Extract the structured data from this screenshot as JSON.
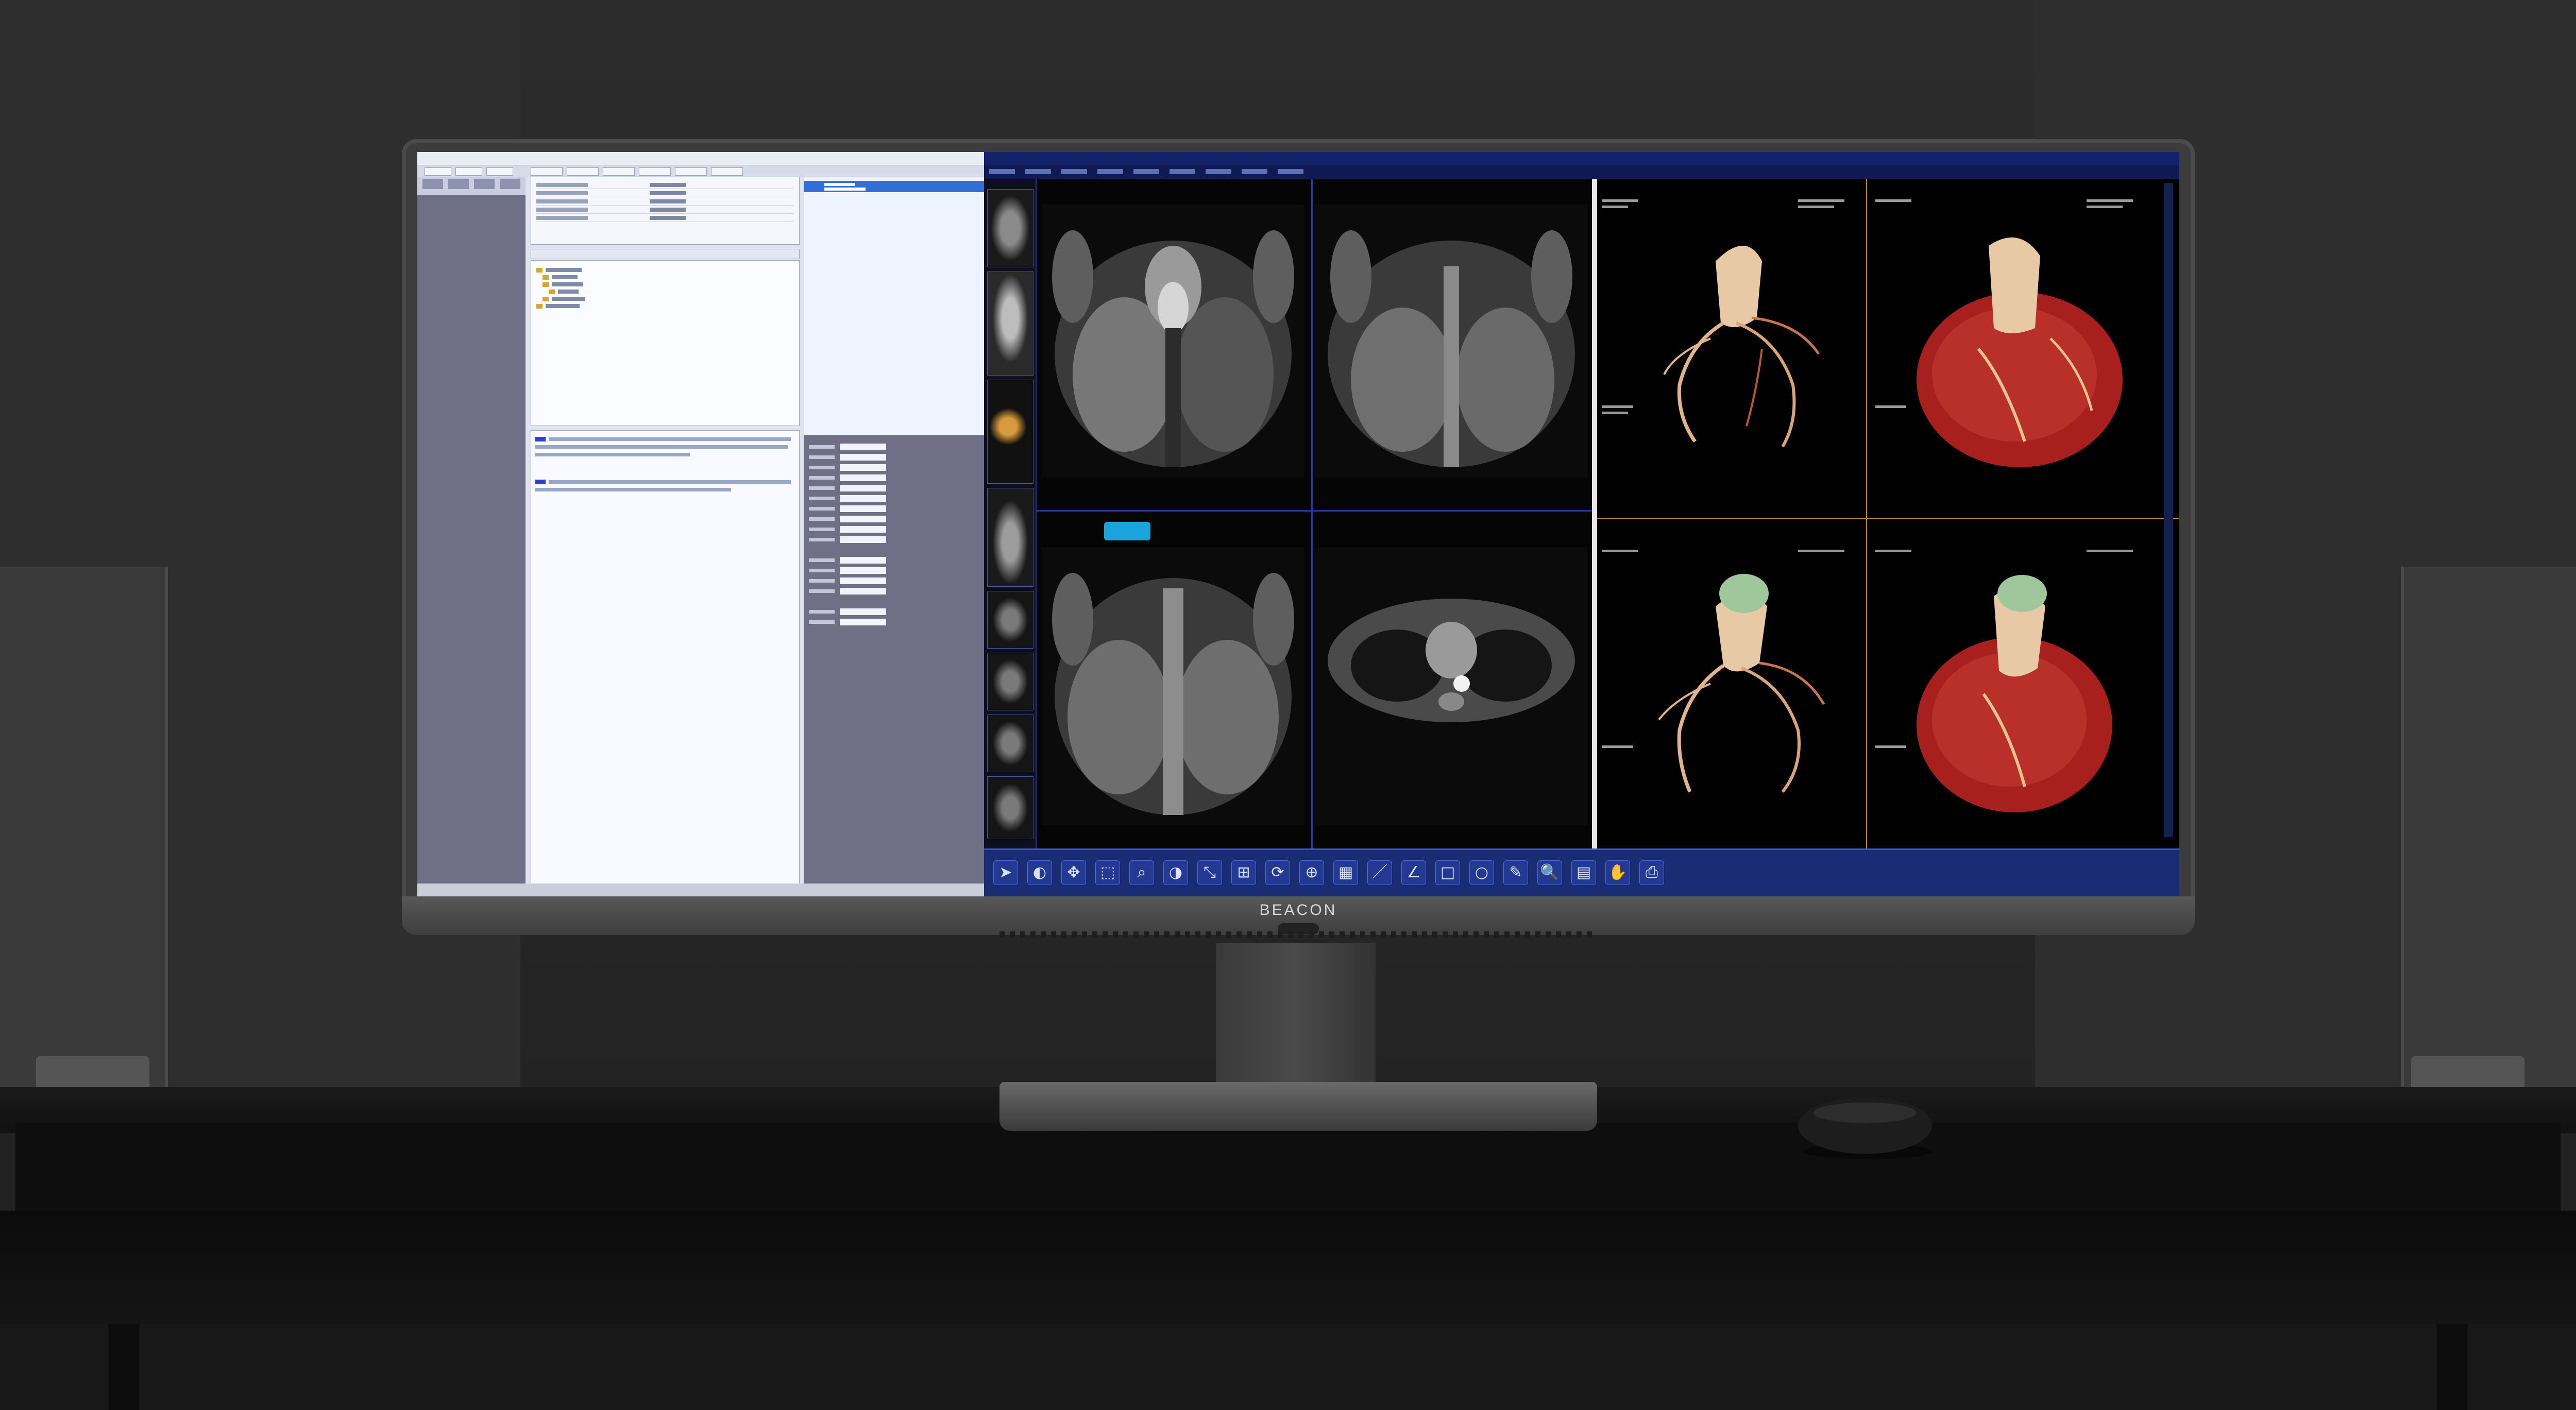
{
  "brand": {
    "name": "BEACON"
  },
  "toolbar": {
    "tools": [
      {
        "name": "pointer-tool",
        "glyph": "➤"
      },
      {
        "name": "window-level-tool",
        "glyph": "◐"
      },
      {
        "name": "pan-tool",
        "glyph": "✥"
      },
      {
        "name": "select-tool",
        "glyph": "⬚"
      },
      {
        "name": "zoom-tool",
        "glyph": "⌕"
      },
      {
        "name": "contrast-tool",
        "glyph": "◑"
      },
      {
        "name": "scale-tool",
        "glyph": "⤡"
      },
      {
        "name": "fit-tool",
        "glyph": "⊞"
      },
      {
        "name": "rotate-tool",
        "glyph": "⟳"
      },
      {
        "name": "layout-tool",
        "glyph": "⊕"
      },
      {
        "name": "grid-tool",
        "glyph": "▦"
      },
      {
        "name": "ruler-tool",
        "glyph": "／"
      },
      {
        "name": "angle-tool",
        "glyph": "∠"
      },
      {
        "name": "rectangle-tool",
        "glyph": "□"
      },
      {
        "name": "ellipse-tool",
        "glyph": "○"
      },
      {
        "name": "annotate-tool",
        "glyph": "✎"
      },
      {
        "name": "magnify-tool",
        "glyph": "🔍"
      },
      {
        "name": "lut-tool",
        "glyph": "▤"
      },
      {
        "name": "hand-tool",
        "glyph": "✋"
      },
      {
        "name": "print-tool",
        "glyph": "⎙"
      }
    ]
  },
  "colors": {
    "toolbar_bg": "#1a2c74",
    "marker": "#1aa4dd",
    "heart_red": "#a8201e",
    "aorta": "#e8c9a6",
    "crosshair": "#b58a20"
  }
}
